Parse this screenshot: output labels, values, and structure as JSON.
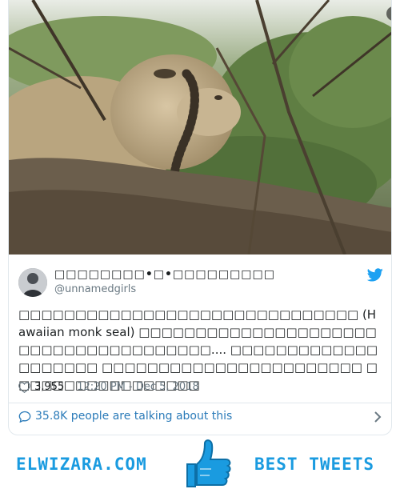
{
  "tweet": {
    "display_name": "□□□□□□□□•□•□□□□□□□□□",
    "handle": "@unnamedgirls",
    "text": "□□□□□□□□□□□□□□□□□□□□□□□□□□□□□□ (Hawaiian monk seal) □□□□□□□□□□□□□□□□□□□□□□□□□□□□□□□□□□□□□□.... □□□□□□□□□□□□□□□□□□□□ □□□□□□□□□□□□□□□□□□□□□□□ □□□□□□□□□□□□□□□□□",
    "likes": "3,955",
    "timestamp": "12:20 PM - Dec 5, 2018",
    "talking": "35.8K people are talking about this"
  },
  "icons": {
    "info": "info-icon",
    "twitter": "twitter-bird-icon",
    "like": "heart-icon",
    "conversation": "speech-bubble-icon",
    "more": "chevron-right-icon",
    "thumb": "thumbs-up-icon"
  },
  "banner": {
    "left_text": "ELWIZARA.COM",
    "right_text": "BEST TWEETS"
  },
  "colors": {
    "link": "#2b7bb9",
    "twitter_blue": "#1da1f2",
    "banner_blue": "#1a9be0",
    "secondary_text": "#697882"
  }
}
